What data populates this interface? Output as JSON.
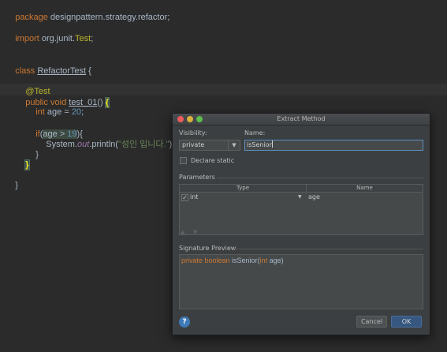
{
  "editor": {
    "package_kw": "package",
    "package_name": " designpattern.strategy.refactor;",
    "import_kw": "import",
    "import_pkg": " org.junit.",
    "import_cls": "Test",
    "import_semi": ";",
    "class_kw": "class",
    "class_name": "RefactorTest",
    "class_open": " {",
    "annotation": "@Test",
    "public_kw": "public",
    "void_kw": " void ",
    "method_name": "test_01",
    "method_parens": "() ",
    "method_brace": "{",
    "int_kw": "int",
    "age_decl": " age = ",
    "age_value": "20",
    "age_semi": ";",
    "if_kw": "if",
    "if_paren": "(",
    "cond_text": "age > ",
    "cond_num": "19",
    "if_close": "){",
    "println_obj": "System.",
    "println_out": "out",
    "println_call": ".println(",
    "println_str": "\"성인 입니다.\"",
    "println_end": ");",
    "inner_close": "}",
    "method_close": "}",
    "class_close": "}"
  },
  "dialog": {
    "title": "Extract Method",
    "visibility_label": "Visibility:",
    "visibility_value": "private",
    "name_label": "Name:",
    "name_value": "isSenior",
    "declare_static_label": "Declare static",
    "declare_static_checked": false,
    "parameters_label": "Parameters",
    "columns": [
      "Type",
      "Name"
    ],
    "params": [
      {
        "checked": true,
        "type": "int",
        "name": "age"
      }
    ],
    "signature_label": "Signature Preview",
    "signature": {
      "modifiers": "private boolean",
      "method": " isSenior(",
      "param_type": "int",
      "param_name": " age)"
    },
    "cancel_label": "Cancel",
    "ok_label": "OK",
    "help_label": "?"
  },
  "colors": {
    "background": "#2b2b2b",
    "keyword": "#cc7832",
    "number": "#6897bb",
    "string": "#6a8759",
    "annotation": "#bbb529",
    "default_text": "#a9b7c6"
  }
}
